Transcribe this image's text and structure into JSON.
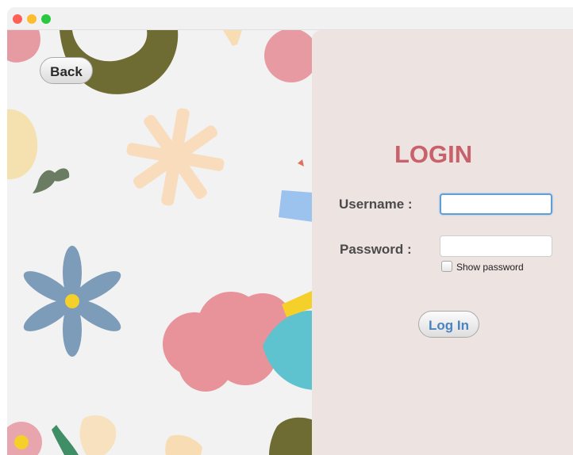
{
  "window": {
    "title": "",
    "controls": [
      "close",
      "minimize",
      "zoom"
    ]
  },
  "navigation": {
    "back_label": "Back"
  },
  "login_form": {
    "title": "LOGIN",
    "username_label": "Username :",
    "username_value": "",
    "password_label": "Password :",
    "password_value": "",
    "show_password_label": "Show password",
    "show_password_checked": false,
    "submit_label": "Log In"
  },
  "colors": {
    "panel_background": "#ede3e1",
    "title": "#c9616b",
    "button_text": "#4a84c0",
    "focus_ring": "#5f9fd8"
  }
}
